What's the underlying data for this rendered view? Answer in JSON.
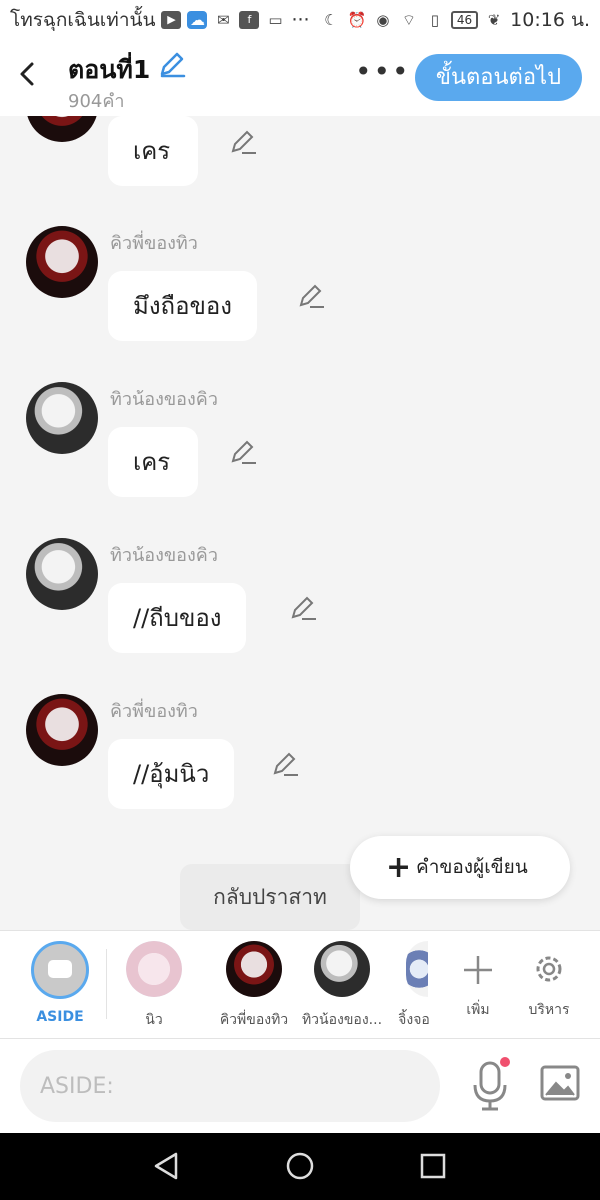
{
  "status_bar": {
    "notification_text": "โทรฉุกเฉินเท่านั้น",
    "more_indicator": "···",
    "battery": "46",
    "time": "10:16 น."
  },
  "header": {
    "title": "ตอนที่1",
    "word_count": "904คำ",
    "more_label": "•••",
    "next_button": "ขั้นตอนต่อไป"
  },
  "messages": [
    {
      "sender": "",
      "text": "เคร"
    },
    {
      "sender": "คิวพี่ของทิว",
      "text": "มึงถือของ"
    },
    {
      "sender": "ทิวน้องของคิว",
      "text": "เคร"
    },
    {
      "sender": "ทิวน้องของคิว",
      "text": "//ถีบของ"
    },
    {
      "sender": "คิวพี่ของทิว",
      "text": "//อุ้มนิว"
    }
  ],
  "author_button": {
    "plus": "+",
    "label": "คำของผู้เขียน"
  },
  "castle_chip": "กลับปราสาท",
  "characters": {
    "aside_label": "ASIDE",
    "items": [
      {
        "label": "นิว"
      },
      {
        "label": "คิวพี่ของทิว"
      },
      {
        "label": "ทิวน้องของ..."
      },
      {
        "label": "จิ้งจอ"
      }
    ],
    "add_label": "เพิ่ม",
    "manage_label": "บริหาร"
  },
  "input": {
    "placeholder": "ASIDE:"
  },
  "colors": {
    "accent": "#5aa9ee",
    "bubble": "#ffffff",
    "background": "#f4f4f4",
    "record_dot": "#f0506e"
  }
}
